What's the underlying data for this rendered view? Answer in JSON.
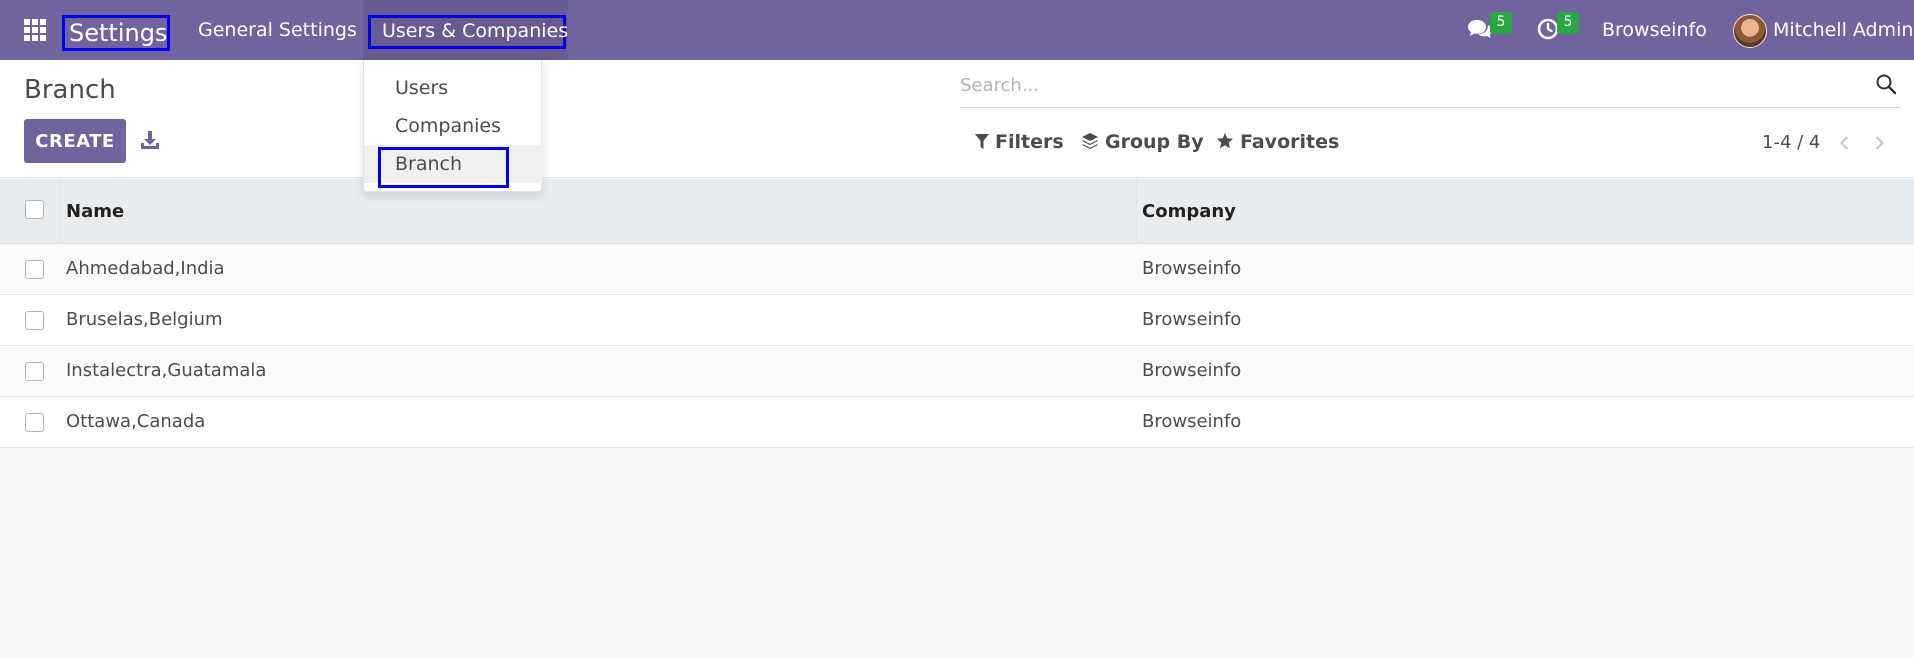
{
  "navbar": {
    "brand": "Settings",
    "menus": {
      "general_settings": "General Settings",
      "users_companies": "Users & Companies"
    },
    "systray": {
      "messages_badge": "5",
      "activities_badge": "5",
      "company": "Browseinfo",
      "user": "Mitchell Admin"
    }
  },
  "dropdown": {
    "items": [
      "Users",
      "Companies",
      "Branch"
    ]
  },
  "control_panel": {
    "breadcrumb": "Branch",
    "create_label": "CREATE",
    "search_placeholder": "Search...",
    "filters_label": "Filters",
    "groupby_label": "Group By",
    "favorites_label": "Favorites",
    "pager": "1-4 / 4"
  },
  "table": {
    "columns": [
      "Name",
      "Company"
    ],
    "rows": [
      {
        "name": "Ahmedabad,India",
        "company": "Browseinfo"
      },
      {
        "name": "Bruselas,Belgium",
        "company": "Browseinfo"
      },
      {
        "name": "Instalectra,Guatamala",
        "company": "Browseinfo"
      },
      {
        "name": "Ottawa,Canada",
        "company": "Browseinfo"
      }
    ]
  },
  "colors": {
    "brand": "#71639e",
    "badge": "#28a745",
    "highlight_box": "#0000ee"
  }
}
